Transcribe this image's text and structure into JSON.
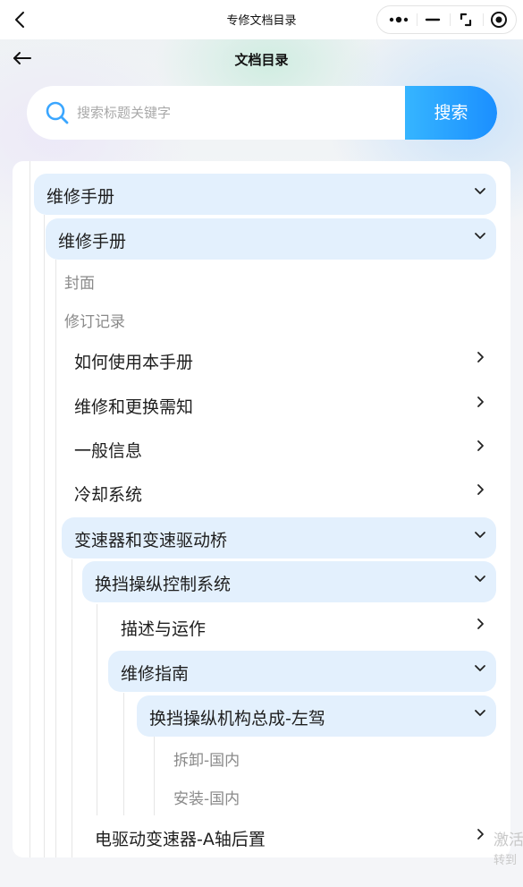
{
  "navbar": {
    "title": "专修文档目录"
  },
  "header": {
    "title": "文档目录"
  },
  "search": {
    "placeholder": "搜索标题关键字",
    "button_label": "搜索"
  },
  "tree": {
    "n1": "维修手册",
    "n2": "维修手册",
    "cover": "封面",
    "revision": "修订记录",
    "how_to_use": "如何使用本手册",
    "repair_notes": "维修和更换需知",
    "general_info": "一般信息",
    "cooling": "冷却系统",
    "transmission": "变速器和变速驱动桥",
    "shift_control": "换挡操纵控制系统",
    "description": "描述与运作",
    "repair_guide": "维修指南",
    "shift_assembly": "换挡操纵机构总成-左驾",
    "removal": "拆卸-国内",
    "install": "安装-国内",
    "e_drive": "电驱动变速器-A轴后置"
  },
  "overlay": {
    "line1": "激活",
    "line2": "转到"
  },
  "icons": {
    "back": "chevron-left-icon",
    "more": "more-dots-icon",
    "minimize": "minus-icon",
    "resize": "corner-arrows-icon",
    "close": "target-icon",
    "header_back": "arrow-left-icon",
    "search": "search-icon",
    "expanded": "chevron-down-icon",
    "collapsed": "chevron-right-icon"
  },
  "colors": {
    "accent": "#1b8fff",
    "expanded_bg": "#e3f0fd",
    "leaf_text": "#8a8a8a"
  }
}
